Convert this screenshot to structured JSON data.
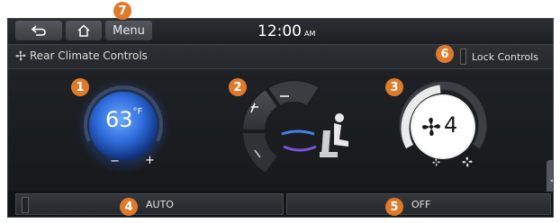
{
  "topbar": {
    "back_icon": "back-arrow-icon",
    "home_icon": "home-icon",
    "menu_label": "Menu",
    "time": "12:00",
    "ampm": "AM"
  },
  "titlebar": {
    "icon": "fan-icon",
    "title": "Rear Climate Controls",
    "lock_label": "Lock Controls"
  },
  "temperature": {
    "value": "63",
    "unit": "°F",
    "minus": "−",
    "plus": "+"
  },
  "fan": {
    "speed": "4",
    "icon": "fan-icon"
  },
  "bottom": {
    "auto_label": "AUTO",
    "off_label": "OFF"
  },
  "callouts": [
    "1",
    "2",
    "3",
    "4",
    "5",
    "6",
    "7"
  ],
  "colors": {
    "callout": "#e07a2b",
    "dial_blue": "#2e7bff",
    "airflow": "#4a8cff"
  }
}
